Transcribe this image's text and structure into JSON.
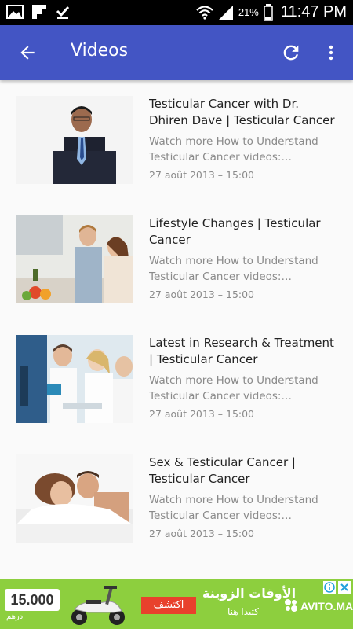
{
  "status_bar": {
    "battery": "21%",
    "time": "11:47 PM"
  },
  "app_bar": {
    "title": "Videos"
  },
  "videos": [
    {
      "title": "Testicular Cancer with Dr. Dhiren Dave | Testicular Cancer",
      "description": "Watch more How to Understand Testicular Cancer videos: http://www.howcast.com",
      "date": "27 août 2013 – 15:00"
    },
    {
      "title": "Lifestyle Changes | Testicular Cancer",
      "description": "Watch more How to Understand Testicular Cancer videos: http://www.howcast.com",
      "date": "27 août 2013 – 15:00"
    },
    {
      "title": "Latest in Research & Treatment | Testicular Cancer",
      "description": "Watch more How to Understand Testicular Cancer videos: http://www.howcast.com",
      "date": "27 août 2013 – 15:00"
    },
    {
      "title": "Sex & Testicular Cancer | Testicular Cancer",
      "description": "Watch more How to Understand Testicular Cancer videos: http://www.howcast.com",
      "date": "27 août 2013 – 15:00"
    }
  ],
  "ad": {
    "price": "15.000",
    "currency": "درهم",
    "cta": "اكتشف",
    "headline": "الأوقات الزوينة",
    "subline": "كتبدا هنا",
    "brand": "AVITO.MA"
  },
  "colors": {
    "app_bar": "#4355c4",
    "ad_background": "#8dcf3e",
    "ad_cta": "#e8412c"
  }
}
